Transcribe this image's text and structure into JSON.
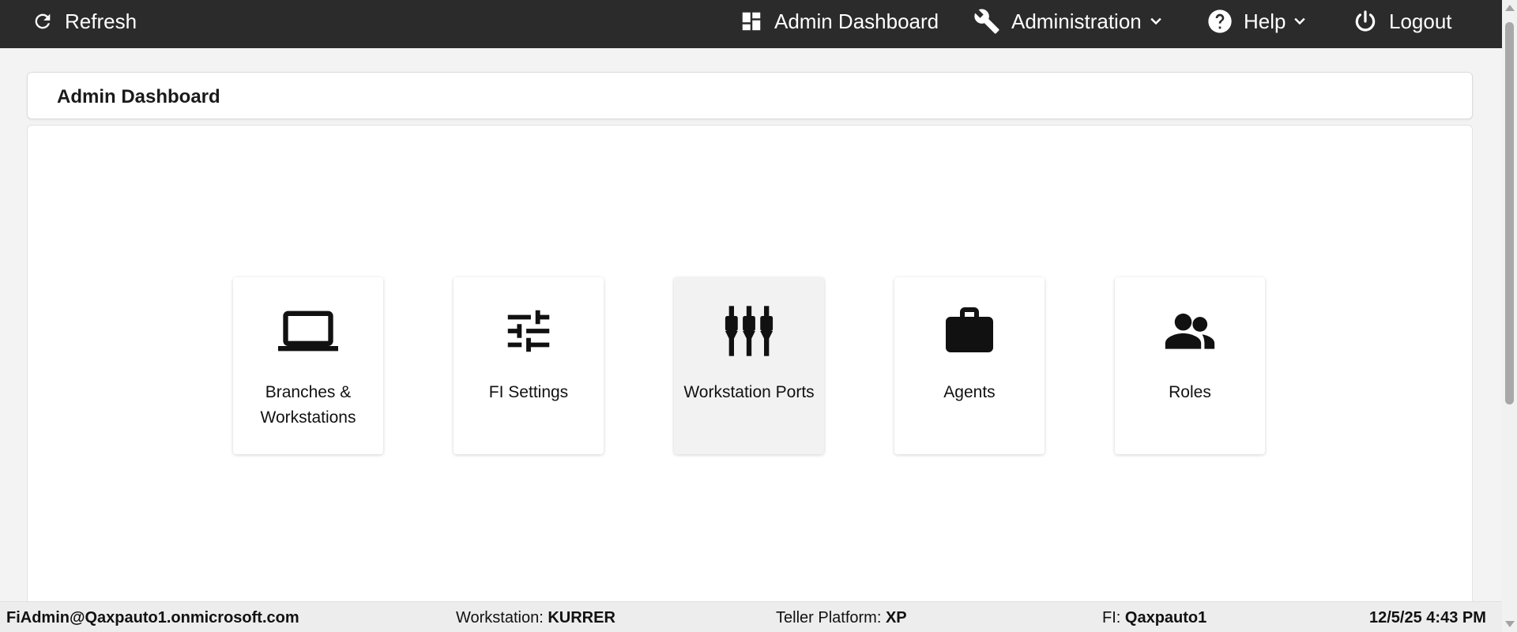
{
  "topbar": {
    "refresh_label": "Refresh",
    "admin_dashboard_label": "Admin Dashboard",
    "administration_label": "Administration",
    "help_label": "Help",
    "logout_label": "Logout"
  },
  "page": {
    "title": "Admin Dashboard"
  },
  "tiles": [
    {
      "label": "Branches & Workstations",
      "icon": "laptop-icon"
    },
    {
      "label": "FI Settings",
      "icon": "sliders-icon"
    },
    {
      "label": "Workstation Ports",
      "icon": "ports-icon"
    },
    {
      "label": "Agents",
      "icon": "briefcase-icon"
    },
    {
      "label": "Roles",
      "icon": "people-icon"
    }
  ],
  "status": {
    "user": "FiAdmin@Qaxpauto1.onmicrosoft.com",
    "workstation_label": "Workstation:",
    "workstation_value": "KURRER",
    "platform_label": "Teller Platform:",
    "platform_value": "XP",
    "fi_label": "FI:",
    "fi_value": "Qaxpauto1",
    "datetime": "12/5/25 4:43 PM"
  },
  "colors": {
    "topbar_bg": "#2b2b2b",
    "page_bg": "#f3f3f3",
    "tile_hover_bg": "#f2f2f2",
    "statusbar_bg": "#ededed"
  }
}
